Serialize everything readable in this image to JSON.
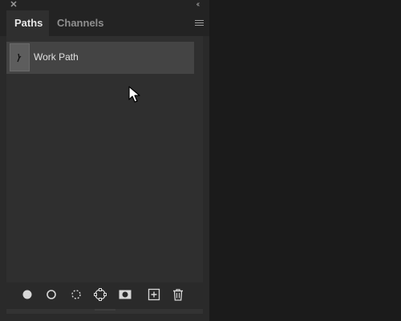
{
  "panel": {
    "tabs": [
      {
        "label": "Paths",
        "active": true
      },
      {
        "label": "Channels",
        "active": false
      }
    ],
    "titlebar": {
      "close_icon": "close-icon",
      "collapse_icon": "double-chevron-left-icon"
    },
    "menu_icon": "panel-menu-icon"
  },
  "paths": [
    {
      "name": "Work Path",
      "selected": true
    }
  ],
  "footer": {
    "buttons": [
      {
        "icon": "fill-path-icon"
      },
      {
        "icon": "stroke-path-icon"
      },
      {
        "icon": "load-path-as-selection-icon"
      },
      {
        "icon": "make-work-path-from-selection-icon"
      },
      {
        "icon": "add-mask-icon"
      },
      {
        "icon": "create-new-path-icon"
      },
      {
        "icon": "delete-path-icon"
      }
    ]
  },
  "colors": {
    "panel_bg": "#2f2f2f",
    "selected_row": "#444444",
    "text_active": "#e6e6e6",
    "text_inactive": "#8f8f8f"
  }
}
